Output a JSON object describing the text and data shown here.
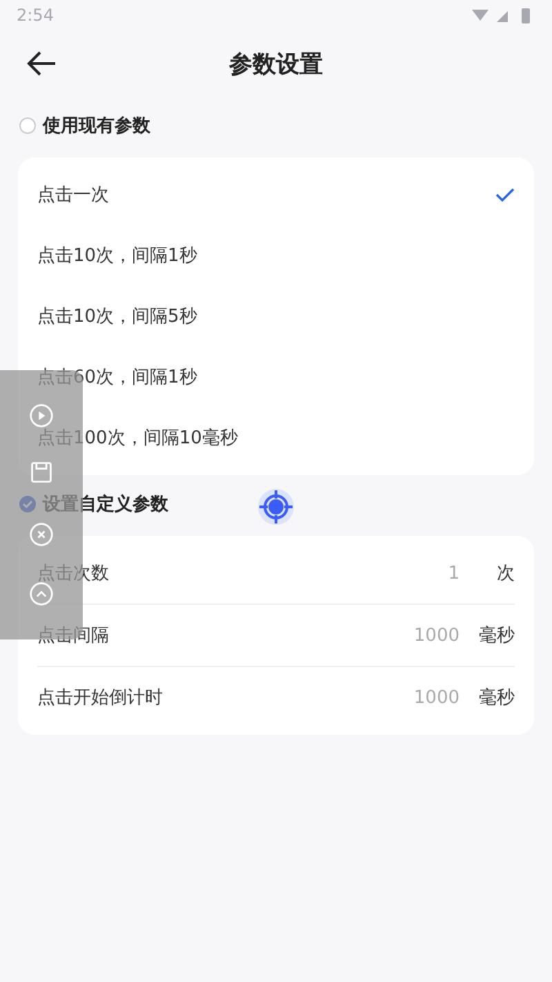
{
  "status_bar": {
    "time": "2:54"
  },
  "header": {
    "title": "参数设置"
  },
  "preset": {
    "label": "使用现有参数",
    "selected": false,
    "options": [
      {
        "label": "点击一次",
        "selected": true
      },
      {
        "label": "点击10次，间隔1秒",
        "selected": false
      },
      {
        "label": "点击10次，间隔5秒",
        "selected": false
      },
      {
        "label": "点击60次，间隔1秒",
        "selected": false
      },
      {
        "label": "点击100次，间隔10毫秒",
        "selected": false
      }
    ]
  },
  "custom": {
    "label": "设置自定义参数",
    "selected": true,
    "fields": [
      {
        "label": "点击次数",
        "value": "1",
        "unit": "次"
      },
      {
        "label": "点击间隔",
        "value": "1000",
        "unit": "毫秒"
      },
      {
        "label": "点击开始倒计时",
        "value": "1000",
        "unit": "毫秒"
      }
    ]
  }
}
